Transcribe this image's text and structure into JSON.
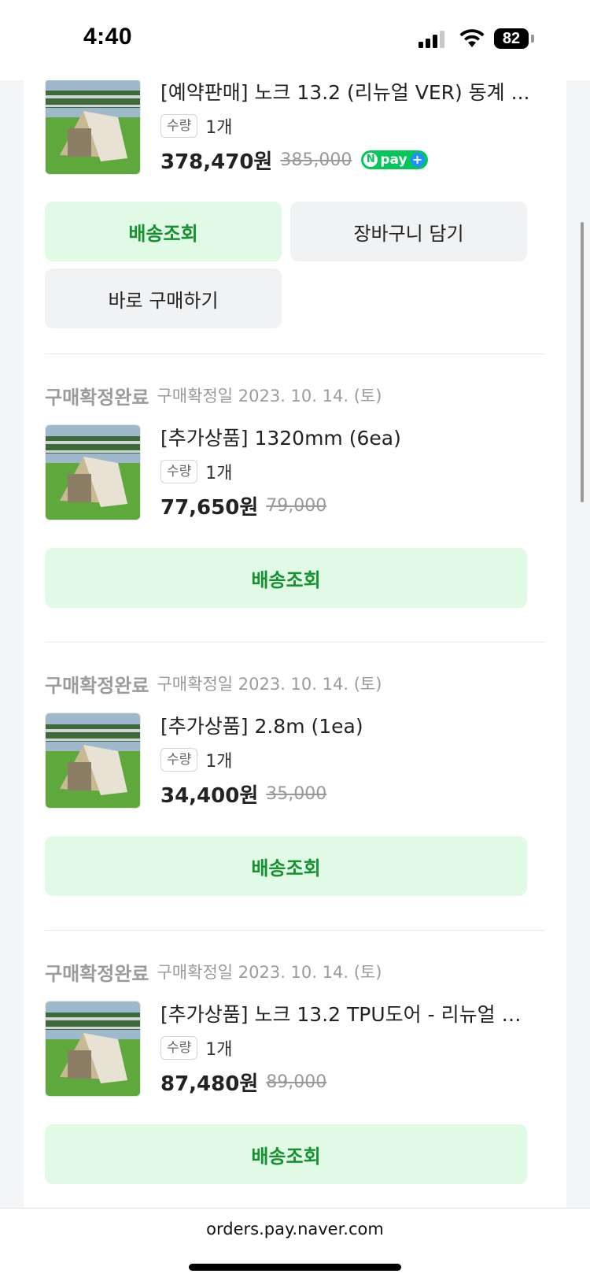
{
  "status_bar": {
    "time": "4:40",
    "battery": "82"
  },
  "items": [
    {
      "name": "[예약판매] 노크 13.2 (리뉴얼 VER) 동계 ...",
      "qty_label": "수량",
      "qty": "1개",
      "price": "378,470원",
      "original_price": "385,000",
      "npay": {
        "n": "N",
        "text": "pay",
        "plus": "+"
      },
      "buttons": {
        "delivery": "배송조회",
        "cart": "장바구니 담기",
        "buy_now": "바로 구매하기"
      }
    },
    {
      "status": "구매확정완료",
      "confirm_date": "구매확정일 2023. 10. 14. (토)",
      "name": "[추가상품] 1320mm (6ea)",
      "qty_label": "수량",
      "qty": "1개",
      "price": "77,650원",
      "original_price": "79,000",
      "buttons": {
        "delivery": "배송조회"
      }
    },
    {
      "status": "구매확정완료",
      "confirm_date": "구매확정일 2023. 10. 14. (토)",
      "name": "[추가상품] 2.8m (1ea)",
      "qty_label": "수량",
      "qty": "1개",
      "price": "34,400원",
      "original_price": "35,000",
      "buttons": {
        "delivery": "배송조회"
      }
    },
    {
      "status": "구매확정완료",
      "confirm_date": "구매확정일 2023. 10. 14. (토)",
      "name": "[추가상품] 노크 13.2 TPU도어 - 리뉴얼 V...",
      "qty_label": "수량",
      "qty": "1개",
      "price": "87,480원",
      "original_price": "89,000",
      "buttons": {
        "delivery": "배송조회"
      }
    }
  ],
  "browser": {
    "url": "orders.pay.naver.com"
  },
  "colors": {
    "green_button_bg": "#e0fae6",
    "green_button_text": "#15922f",
    "gray_button_bg": "#f1f2f4",
    "npay_green": "#03c75a"
  }
}
